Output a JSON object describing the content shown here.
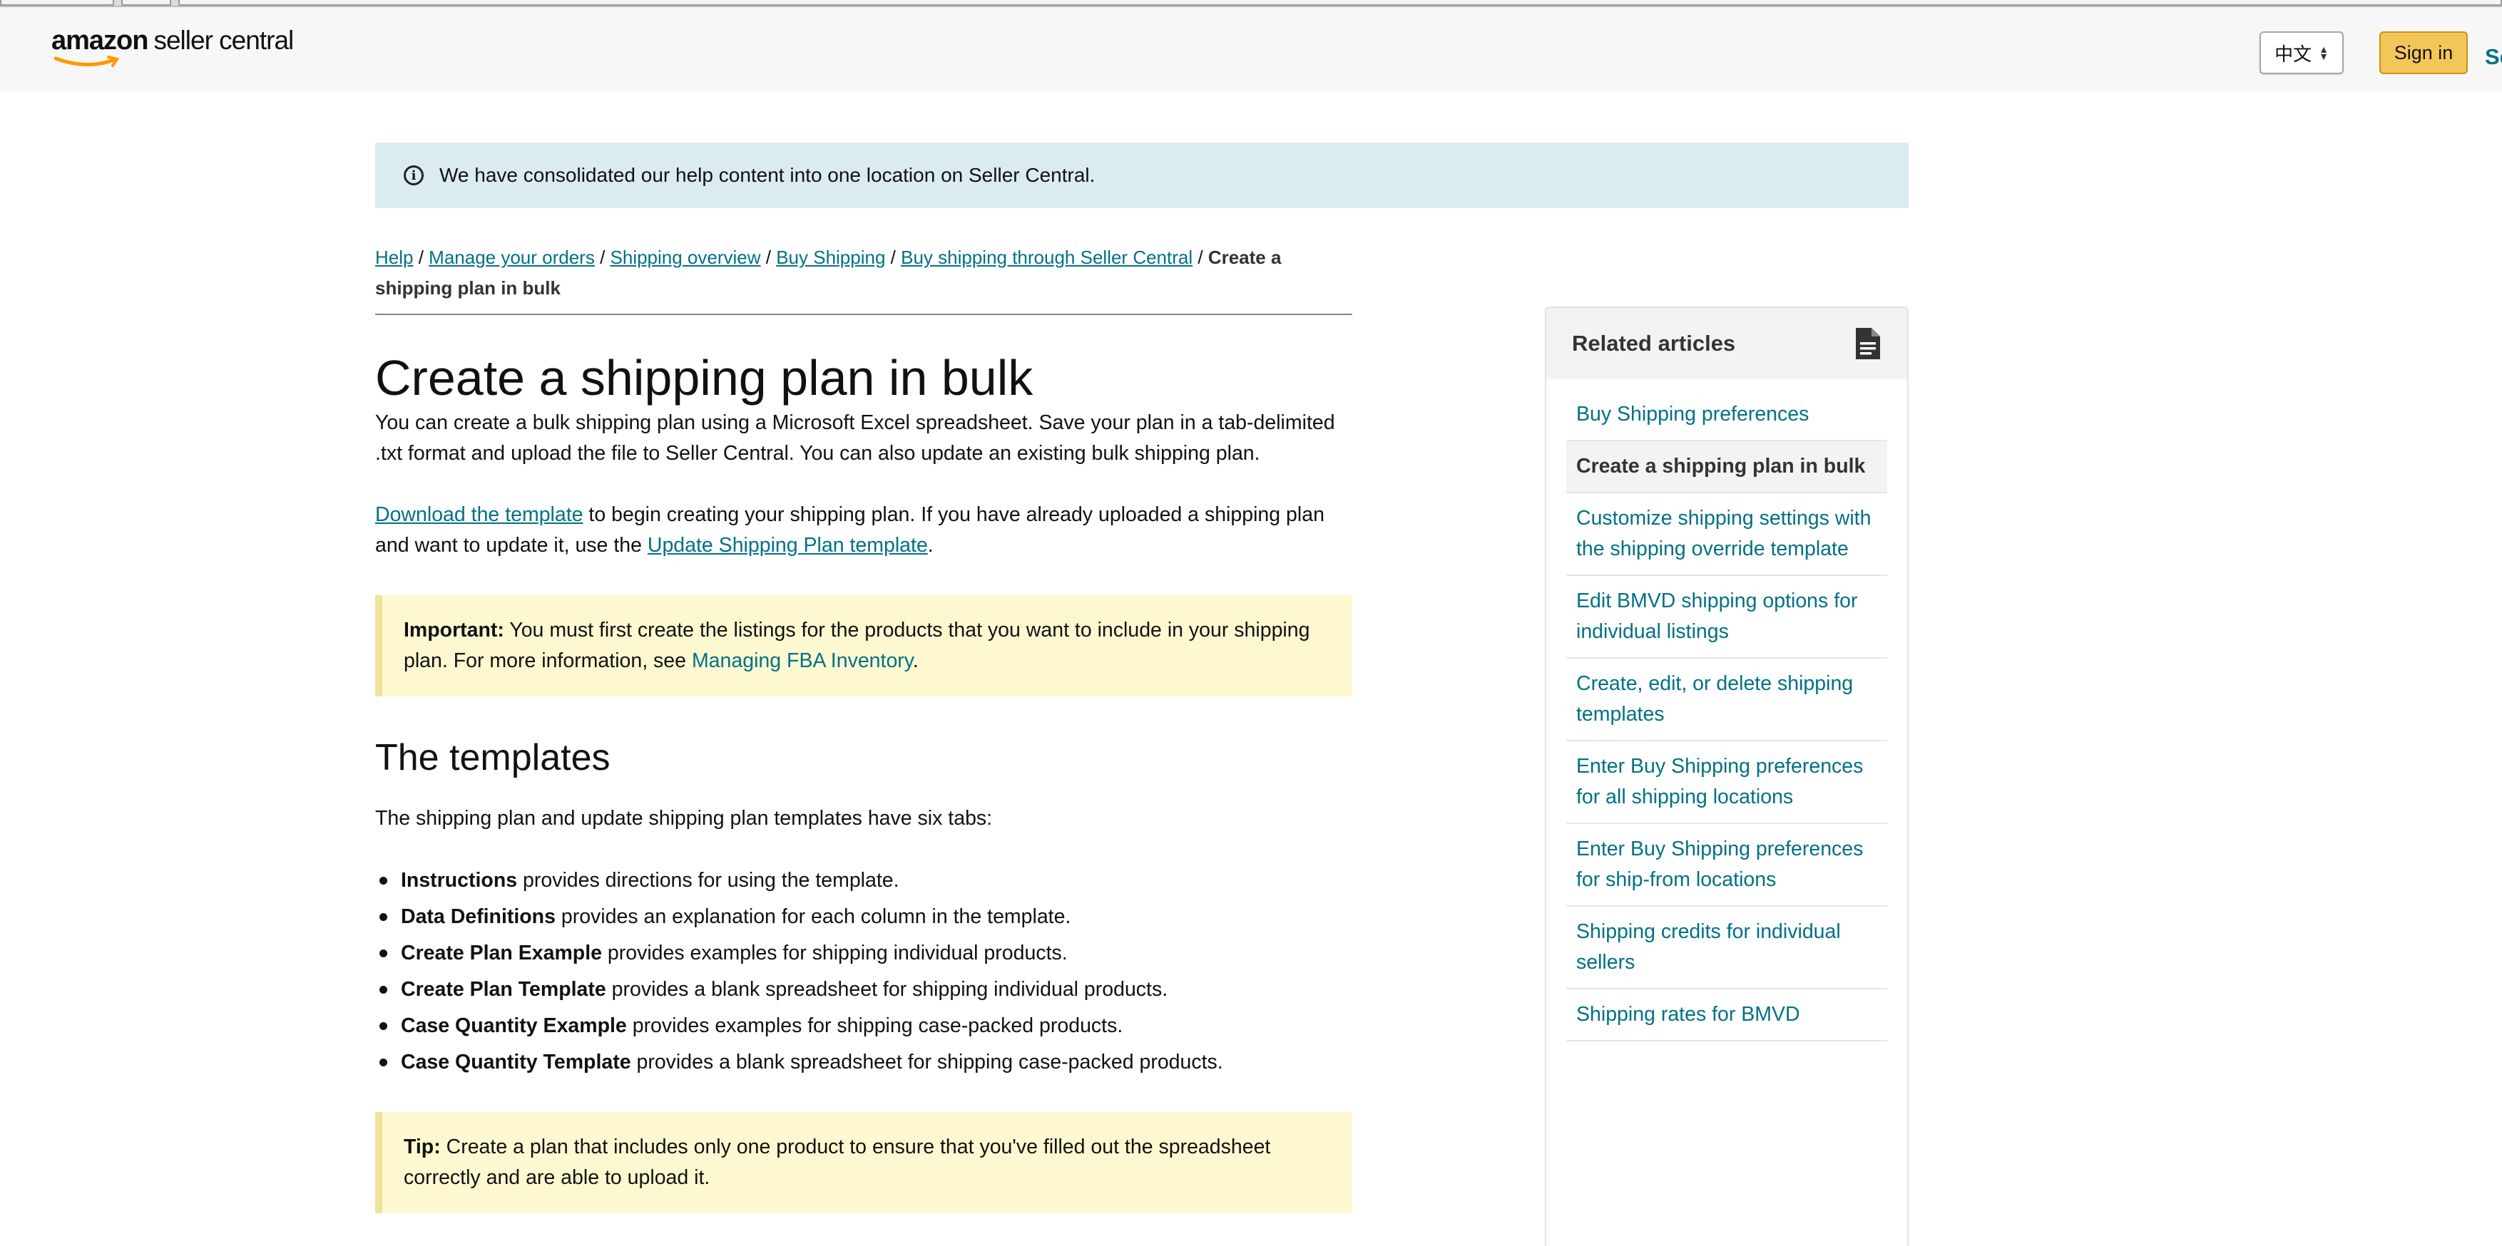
{
  "header": {
    "logo_amazon": "amazon",
    "logo_product": "seller central",
    "language": "中文",
    "sign_in": "Sign in",
    "cut_text": "Se"
  },
  "notice": {
    "text": "We have consolidated our help content into one location on Seller Central."
  },
  "breadcrumb": {
    "items": [
      "Help",
      "Manage your orders",
      "Shipping overview",
      "Buy Shipping",
      "Buy shipping through Seller Central"
    ],
    "separator": " / ",
    "current": "Create a shipping plan in bulk"
  },
  "article": {
    "title": "Create a shipping plan in bulk",
    "intro": "You can create a bulk shipping plan using a Microsoft Excel spreadsheet. Save your plan in a tab-delimited .txt format and upload the file to Seller Central. You can also update an existing bulk shipping plan.",
    "download_link": "Download the template",
    "download_text_1": " to begin creating your shipping plan. If you have already uploaded a shipping plan and want to update it, use the ",
    "update_link": "Update Shipping Plan template",
    "download_text_2": ".",
    "important_label": "Important:",
    "important_text": " You must first create the listings for the products that you want to include in your shipping plan. For more information, see ",
    "important_link": "Managing FBA Inventory",
    "important_end": ".",
    "section_title": "The templates",
    "templates_intro": "The shipping plan and update shipping plan templates have six tabs:",
    "tabs": [
      {
        "name": "Instructions",
        "desc": " provides directions for using the template."
      },
      {
        "name": "Data Definitions",
        "desc": " provides an explanation for each column in the template."
      },
      {
        "name": "Create Plan Example",
        "desc": " provides examples for shipping individual products."
      },
      {
        "name": "Create Plan Template",
        "desc": " provides a blank spreadsheet for shipping individual products."
      },
      {
        "name": "Case Quantity Example",
        "desc": " provides examples for shipping case-packed products."
      },
      {
        "name": "Case Quantity Template",
        "desc": " provides a blank spreadsheet for shipping case-packed products."
      }
    ],
    "tip_label": "Tip:",
    "tip_text": " Create a plan that includes only one product to ensure that you've filled out the spreadsheet correctly and are able to upload it."
  },
  "sidebar": {
    "title": "Related articles",
    "icon": "document-icon",
    "items": [
      {
        "label": "Buy Shipping preferences",
        "active": false
      },
      {
        "label": "Create a shipping plan in bulk",
        "active": true
      },
      {
        "label": "Customize shipping settings with the shipping override template",
        "active": false
      },
      {
        "label": "Edit BMVD shipping options for individual listings",
        "active": false
      },
      {
        "label": "Create, edit, or delete shipping templates",
        "active": false
      },
      {
        "label": "Enter Buy Shipping preferences for all shipping locations",
        "active": false
      },
      {
        "label": "Enter Buy Shipping preferences for ship-from locations",
        "active": false
      },
      {
        "label": "Shipping credits for individual sellers",
        "active": false
      },
      {
        "label": "Shipping rates for BMVD",
        "active": false
      }
    ]
  },
  "colors": {
    "link": "#007185",
    "notice_bg": "#dbecf0",
    "callout_bg": "#fef8d0",
    "signin_bg": "#f3c65a"
  }
}
